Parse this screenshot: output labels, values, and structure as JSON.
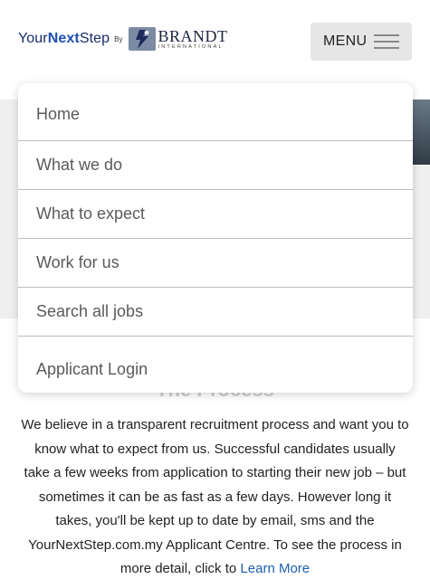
{
  "header": {
    "logo_prefix": "Your",
    "logo_next": "Next",
    "logo_suffix": "Step",
    "logo_by": "By",
    "brandt_name": "BRANDT",
    "brandt_sub": "INTERNATIONAL",
    "menu_label": "MENU"
  },
  "menu": {
    "items": [
      {
        "label": "Home"
      },
      {
        "label": "What we do"
      },
      {
        "label": "What to expect"
      },
      {
        "label": "Work for us"
      },
      {
        "label": "Search all jobs"
      },
      {
        "label": "Applicant Login"
      }
    ]
  },
  "content": {
    "section_title": "The Process",
    "paragraph": "We believe in a transparent recruitment process and want you to know what to expect from us. Successful candidates usually take a few weeks from application to starting their new job – but sometimes it can be as fast as a few days. However long it takes, you'll be kept up to date by email, sms and the YourNextStep.com.my Applicant Centre. To see the process in more detail, click to",
    "link_label": "Learn More"
  },
  "colors": {
    "link": "#1f5fb0",
    "menu_button_bg": "#e6e6e6",
    "menu_item_text": "#5a5a5a"
  }
}
